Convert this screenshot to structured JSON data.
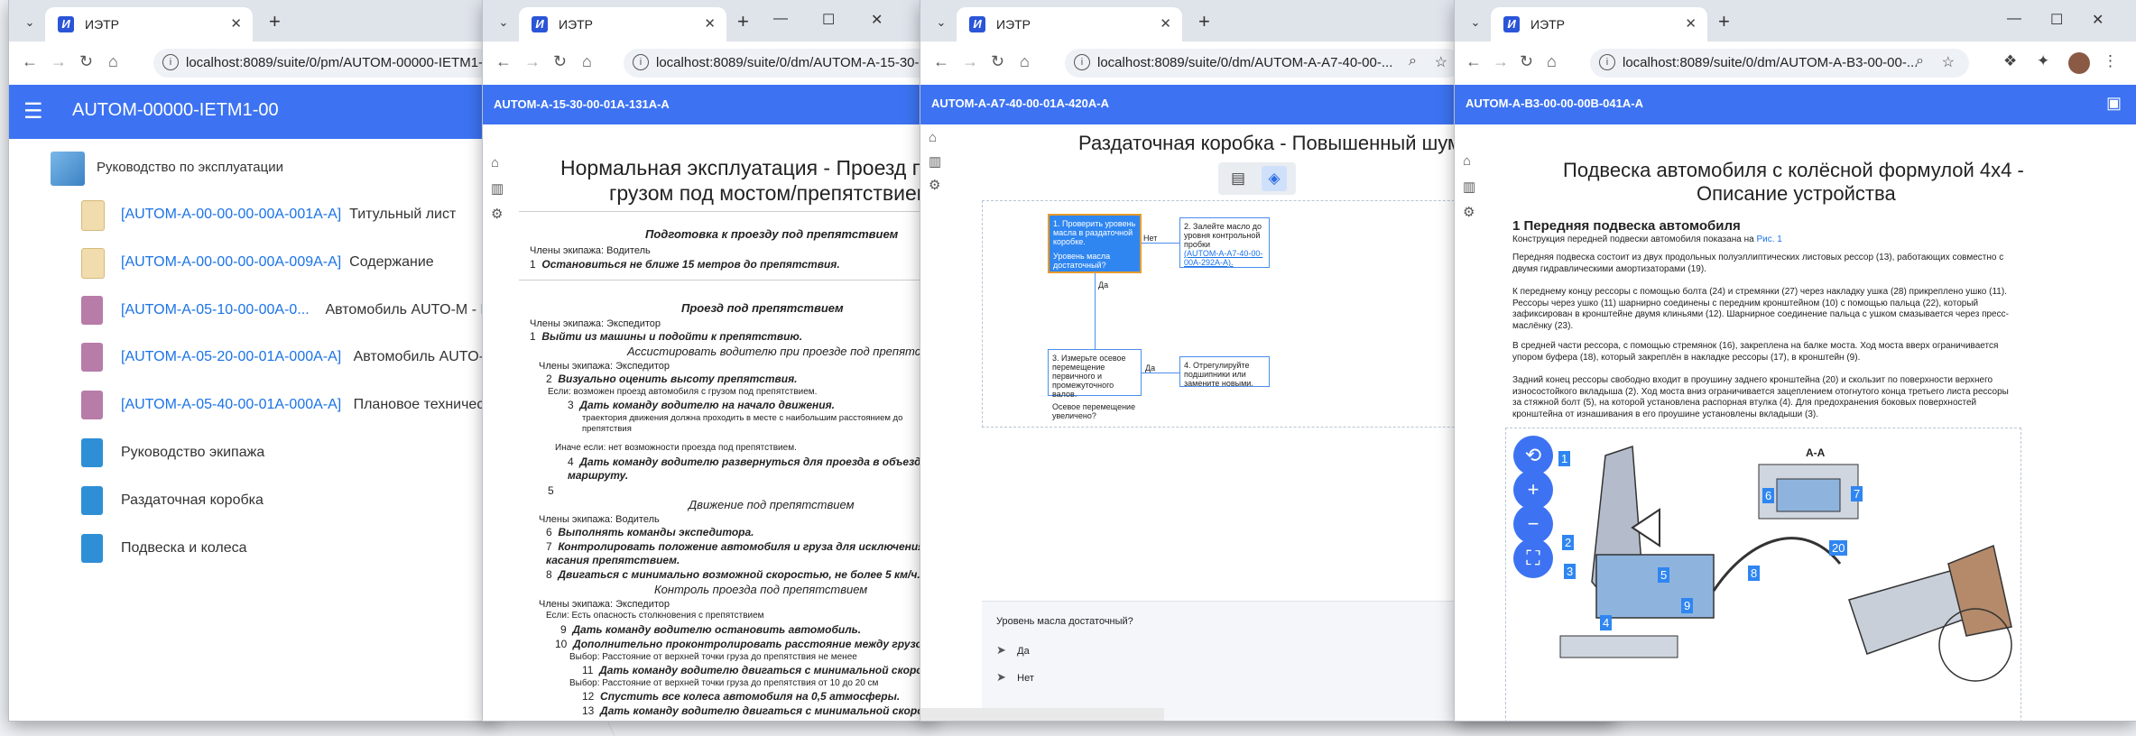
{
  "tab_title": "ИЭТР",
  "w1": {
    "url": "localhost:8089/suite/0/pm/AUTOM-00000-IETM1-00",
    "header_title": "AUTOM-00000-IETM1-00",
    "tree": {
      "root": "Руководство по эксплуатации",
      "items": [
        {
          "code": "[AUTOM-A-00-00-00-00A-001A-A]",
          "title": "Титульный лист"
        },
        {
          "code": "[AUTOM-A-00-00-00-00A-009A-A]",
          "title": "Содержание"
        },
        {
          "code": "[AUTOM-A-05-10-00-00A-0...",
          "title": "Автомобиль AUTO-M - Перечень"
        },
        {
          "code": "[AUTOM-A-05-20-00-01A-000A-A]",
          "title": "Автомобиль AUTO-M - Перечень"
        },
        {
          "code": "[AUTOM-A-05-40-00-01A-000A-A]",
          "title": "Плановое техническое обслуживание"
        }
      ],
      "folders": [
        "Руководство экипажа",
        "Раздаточная коробка",
        "Подвеска и колеса"
      ]
    }
  },
  "w2": {
    "url": "localhost:8089/suite/0/dm/AUTOM-A-15-30-00-01A-131A-A",
    "header_title": "AUTOM-A-15-30-00-01A-131A-A",
    "doc_title_1": "Нормальная эксплуатация - Проезд под мостом",
    "doc_title_2": "грузом под мостом/препятствием",
    "sec1": "Подготовка к проезду под препятствием",
    "crew_driver": "Члены экипажа: Водитель",
    "s1": "Остановиться не ближе 15 метров до препятствия.",
    "sec2": "Проезд под препятствием",
    "crew_exp": "Члены экипажа: Экспедитор",
    "s2": "Выйти из машины и подойти к препятствию.",
    "sub1": "Ассистировать водителю при проезде под препятствием",
    "crew_exp2": "Члены экипажа: Экспедитор",
    "s3": "Визуально оценить высоту препятствия.",
    "if1": "Если: возможен проезд автомобиля с грузом под препятствием.",
    "s4": "Дать команду водителю на начало движения.",
    "s4note": "траектория движения должна проходить в месте с наибольшим расстоянием до препятствия",
    "else1": "Иначе если: нет возможности проезда под препятствием.",
    "s5": "Дать команду водителю развернуться для проезда в объезд маршруту.",
    "sub2": "Движение под препятствием",
    "crew_driver2": "Члены экипажа: Водитель",
    "s6": "Выполнять команды экспедитора.",
    "s7": "Контролировать положение автомобиля и груза для исключения касания препятствием.",
    "s8": "Двигаться с минимально возможной скоростью, не более 5 км/ч.",
    "sub3": "Контроль проезда под препятствием",
    "crew_exp3": "Члены экипажа: Экспедитор",
    "if2": "Если: Есть опасность столкновения с препятствием",
    "s9": "Дать команду водителю остановить автомобиль.",
    "s10": "Дополнительно проконтролировать расстояние между грузом",
    "sel1": "Выбор: Расстояние от верхней точки груза до препятствия не менее",
    "s11": "Дать команду водителю двигаться с минимальной скоростью.",
    "sel2": "Выбор: Расстояние от верхней точки груза до препятствия от 10 до 20 см",
    "s12": "Спустить все колеса автомобиля на 0,5 атмосферы.",
    "s13": "Дать команду водителю двигаться с минимальной скоростью.",
    "n1": "1",
    "n2": "1",
    "n3": "2",
    "n4": "3",
    "n5": "4",
    "n6": "5",
    "n7": "6",
    "n8": "7",
    "n9": "8",
    "n10": "9",
    "n11": "10",
    "n12": "11",
    "n13": "12",
    "n14": "13"
  },
  "w3": {
    "url": "localhost:8089/suite/0/dm/AUTOM-A-A7-40-00-...",
    "header_title": "AUTOM-A-A7-40-00-01A-420A-A",
    "doc_title": "Раздаточная коробка - Повышенный шум",
    "box1": "1. Проверить уровень масла в раздаточной коробке.",
    "box1q": "Уровень масла достаточный?",
    "box2": "2. Залейте масло до уровня контрольной пробки",
    "box2link": "(AUTOM-A-A7-40-00-00A-292A-A).",
    "box3": "3. Измерьте осевое перемещение первичного и промежуточного валов.",
    "box3q": "Осевое перемещение увеличено?",
    "box4": "4. Отрегулируйте подшипники или замените новыми.",
    "lbl_no": "Нет",
    "lbl_yes": "Да",
    "lbl_yes2": "Да",
    "question": "Уровень масла достаточный?",
    "ans_yes": "Да",
    "ans_no": "Нет"
  },
  "w4": {
    "url": "localhost:8089/suite/0/dm/AUTOM-A-B3-00-00-...",
    "header_title": "AUTOM-A-B3-00-00-00B-041A-A",
    "doc_title_1": "Подвеска автомобиля с колёсной формулой 4x4 -",
    "doc_title_2": "Описание устройства",
    "h1": "1 Передняя подвеска автомобиля",
    "p0a": "Конструкция передней подвески автомобиля показана на ",
    "p0b": "Рис. 1",
    "p1": "Передняя подвеска состоит из двух продольных полуэллиптических листовых рессор (13), работающих совместно с двумя гидравлическими амортизаторами (19).",
    "p2": "К переднему концу рессоры с помощью болта (24) и стремянки (27) через накладку ушка (28) прикреплено ушко (11). Рессоры через ушко (11) шарнирно соединены с передним кронштейном (10) с помощью пальца (22), который зафиксирован в кронштейне двумя клиньями (12). Шарнирное соединение пальца с ушком смазывается через пресс-маслёнку (23).",
    "p3": "В средней части рессора, с помощью стремянок (16), закреплена на балке моста. Ход моста вверх ограничивается упором буфера (18), который закреплён в накладке рессоры (17), в кронштейн (9).",
    "p4": "Задний конец рессоры свободно входит в проушину заднего кронштейна (20) и скользит по поверхности верхнего износостойкого вкладыша (2). Ход моста вниз ограничивается зацеплением отогнутого конца третьего листа рессоры за стяжной болт (5), на которой установлена распорная втулка (4). Для предохранения боковых поверхностей кронштейна от изнашивания в его проушине установлены вкладыши (3).",
    "aa": "A-A",
    "callouts": [
      "1",
      "2",
      "3",
      "4",
      "5",
      "6",
      "7",
      "8",
      "9",
      "20"
    ]
  }
}
